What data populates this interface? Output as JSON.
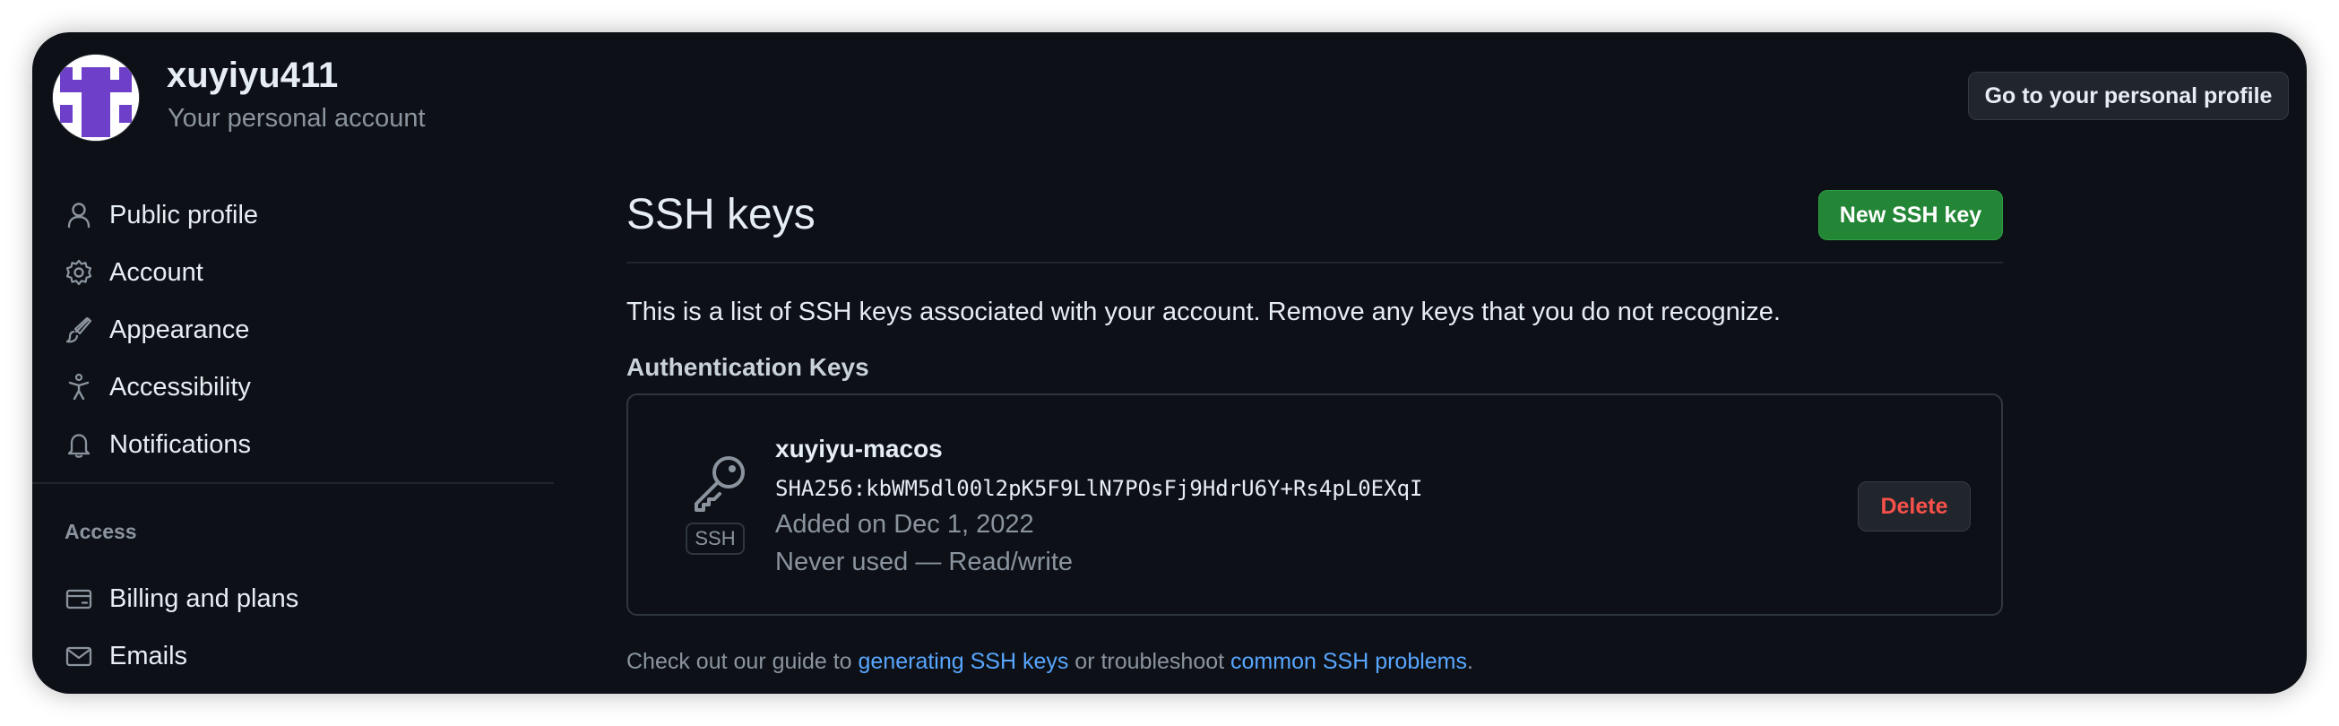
{
  "header": {
    "username": "xuyiyu411",
    "subtitle": "Your personal account",
    "profile_button": "Go to your personal profile"
  },
  "sidebar": {
    "items": [
      {
        "label": "Public profile",
        "icon": "person-icon"
      },
      {
        "label": "Account",
        "icon": "gear-icon"
      },
      {
        "label": "Appearance",
        "icon": "paintbrush-icon"
      },
      {
        "label": "Accessibility",
        "icon": "accessibility-icon"
      },
      {
        "label": "Notifications",
        "icon": "bell-icon"
      }
    ],
    "access_heading": "Access",
    "access_items": [
      {
        "label": "Billing and plans",
        "icon": "credit-card-icon"
      },
      {
        "label": "Emails",
        "icon": "mail-icon"
      }
    ]
  },
  "main": {
    "title": "SSH keys",
    "new_key_button": "New SSH key",
    "description": "This is a list of SSH keys associated with your account. Remove any keys that you do not recognize.",
    "auth_heading": "Authentication Keys",
    "keys": [
      {
        "name": "xuyiyu-macos",
        "fingerprint": "SHA256:kbWM5dl00l2pK5F9LlN7POsFj9HdrU6Y+Rs4pL0EXqI",
        "added": "Added on Dec 1, 2022",
        "usage": "Never used — Read/write",
        "badge": "SSH",
        "icon": "key-icon",
        "delete_label": "Delete"
      }
    ],
    "guide": {
      "prefix": "Check out our guide to ",
      "link1": "generating SSH keys",
      "middle": " or troubleshoot ",
      "link2": "common SSH problems",
      "suffix": "."
    }
  },
  "colors": {
    "background": "#0d1117",
    "text": "#e6edf3",
    "muted": "#8b949e",
    "link": "#58a6ff",
    "primary_button": "#238636",
    "danger": "#f85149",
    "border": "#30363d",
    "avatar": "#6e40c9"
  }
}
